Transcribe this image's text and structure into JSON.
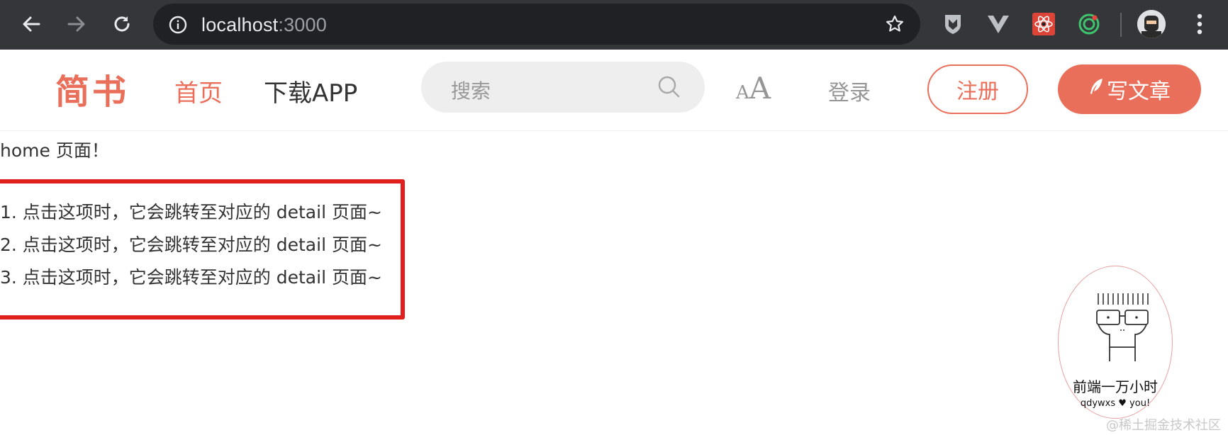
{
  "browser": {
    "url_host": "localhost",
    "url_port": ":3000",
    "icons": [
      "back-arrow-icon",
      "forward-arrow-icon",
      "reload-icon",
      "info-icon",
      "bookmark-star-icon",
      "shield-extension-icon",
      "vue-devtools-icon",
      "react-devtools-icon",
      "target-extension-icon",
      "profile-avatar",
      "more-menu-icon"
    ]
  },
  "header": {
    "logo": "简书",
    "nav_home": "首页",
    "nav_download": "下载APP",
    "search_placeholder": "搜索",
    "font_toggle_small": "A",
    "font_toggle_big": "A",
    "login": "登录",
    "register": "注册",
    "write": "写文章"
  },
  "content": {
    "home_text": "home 页面！",
    "items": [
      "1. 点击这项时，它会跳转至对应的 detail 页面~",
      "2. 点击这项时，它会跳转至对应的 detail 页面~",
      "3. 点击这项时，它会跳转至对应的 detail 页面~"
    ]
  },
  "watermark": {
    "title": "前端一万小时",
    "subtitle": "qdywxs ♥ you!",
    "credit": "@稀土掘金技术社区"
  },
  "colors": {
    "brand": "#ea6f5a",
    "chrome_bg": "#35363a",
    "highlight_border": "#e21f1f"
  }
}
